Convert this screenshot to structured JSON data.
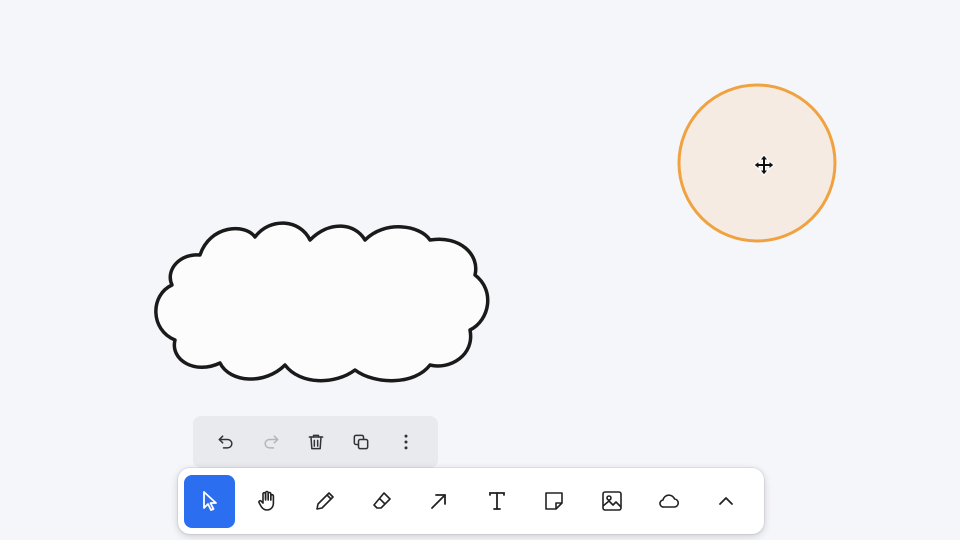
{
  "canvas": {
    "shapes": [
      {
        "kind": "cloud",
        "fill": "#fcfcfd",
        "stroke": "#1a1a1a"
      },
      {
        "kind": "circle",
        "fill": "#f6ebe2",
        "stroke": "#f0a240",
        "selected": true
      }
    ]
  },
  "action_bar": {
    "items": [
      {
        "name": "undo-icon",
        "enabled": true
      },
      {
        "name": "redo-icon",
        "enabled": false
      },
      {
        "name": "trash-icon",
        "enabled": true
      },
      {
        "name": "duplicate-icon",
        "enabled": true
      },
      {
        "name": "more-vertical-icon",
        "enabled": true
      }
    ]
  },
  "toolbar": {
    "active_tool": "select",
    "accent_color": "#2b6ff0",
    "tools": [
      {
        "id": "select",
        "icon": "cursor-arrow-icon"
      },
      {
        "id": "hand",
        "icon": "hand-icon"
      },
      {
        "id": "draw",
        "icon": "pencil-icon"
      },
      {
        "id": "eraser",
        "icon": "eraser-icon"
      },
      {
        "id": "arrow",
        "icon": "arrow-icon"
      },
      {
        "id": "text",
        "icon": "text-icon"
      },
      {
        "id": "note",
        "icon": "sticky-note-icon"
      },
      {
        "id": "image",
        "icon": "image-icon"
      },
      {
        "id": "shape",
        "icon": "cloud-icon"
      },
      {
        "id": "more",
        "icon": "chevron-up-icon"
      }
    ]
  }
}
